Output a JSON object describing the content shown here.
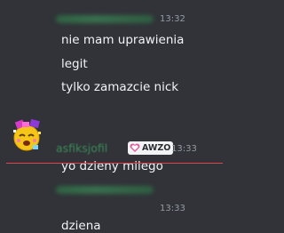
{
  "messages": [
    {
      "time": "13:32",
      "lines": [
        "nie mam uprawienia",
        "legit",
        "tylko zamazcie nick"
      ]
    },
    {
      "username": "asfiksjofil",
      "tag": "AWZO",
      "time": "13:33",
      "lines": [
        "yo dzieny milego"
      ]
    },
    {
      "time": "13:33",
      "lines": [
        "dziena"
      ]
    }
  ],
  "colors": {
    "background": "#313338",
    "text": "#f2f3f5",
    "timestamp": "#949ba4",
    "username": "#3d8a5a",
    "new_messages_divider": "#e0424a",
    "tag_background": "#f2f3f5",
    "tag_heart": "#e05a9a"
  },
  "icons": {
    "avatar": "sparkly-pixel-emoji-avatar",
    "tag_badge": "heart-icon"
  }
}
